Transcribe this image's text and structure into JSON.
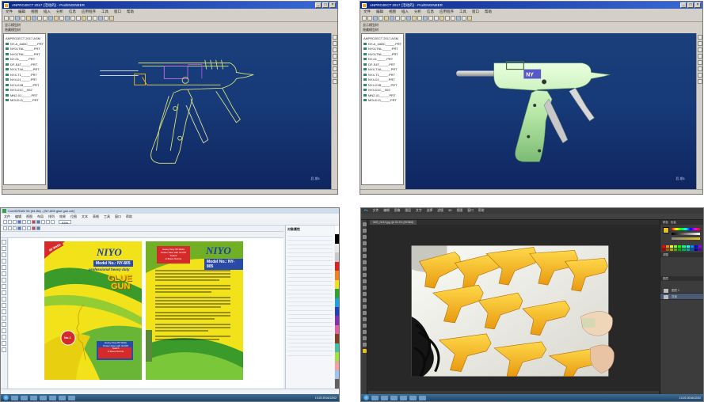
{
  "colors": {
    "cad_viewport": "#173a78",
    "wire": "#d8e07a",
    "shaded_gun": "#c8f0b8",
    "label_yellow": "#f2e21a",
    "label_green": "#3a9a2a",
    "ps_bg": "#2b2b2b",
    "gun_orange": "#f4b21a"
  },
  "cad_left": {
    "title": "ANPROJECT 2017  (活动的)  - Pro/ENGINEER",
    "model_name": "Pro/ENGINEER",
    "menu": [
      "文件",
      "编辑",
      "视图",
      "插入",
      "分析",
      "信息",
      "应用程序",
      "工具",
      "窗口",
      "帮助"
    ],
    "tree_header": "模型树",
    "tree": [
      "ANPROJECT 2017.ASM",
      "NY-A_4ABC_____.PRT",
      "NY01TNL_____.PRT",
      "NY01TNL_____.PRT",
      "NY-01_____.PRT",
      "DF-S4T_____.PRT",
      "NY4-T4A_____.PRT",
      "NY4-T1_____.PRT",
      "NY4-01_____.PRT",
      "NY4-01B_____.PRT",
      "NY4-01C__002",
      "MN2-01_____.PRT",
      "MOLD-D_____.PRT"
    ],
    "toolbar_text": [
      "显示模型树",
      "隐藏模型树"
    ],
    "corner": "后-前1"
  },
  "cad_right": {
    "title": "ANPROJECT 2017  (活动的)  - Pro/ENGINEER",
    "menu": [
      "文件",
      "编辑",
      "视图",
      "插入",
      "分析",
      "信息",
      "应用程序",
      "工具",
      "窗口",
      "帮助"
    ],
    "tree_header": "模型树",
    "tree": [
      "ANPROJECT 2017.ASM",
      "NY-A_4ABC_____.PRT",
      "NY01TNL_____.PRT",
      "NY01TNL_____.PRT",
      "NY-01_____.PRT",
      "DF-S4T_____.PRT",
      "NY4-T4A_____.PRT",
      "NY4-T1_____.PRT",
      "NY4-01_____.PRT",
      "NY4-01B_____.PRT",
      "NY4-01C__002",
      "MN2-01_____.PRT",
      "MOLD-D_____.PRT"
    ],
    "toolbar_text": [
      "显示模型树",
      "隐藏模型树"
    ],
    "corner": "后-前1"
  },
  "corel": {
    "title": "CorelDRAW X6 (64-Bit) - [NY-805 glue gun.cdr]",
    "menu": [
      "文件",
      "编辑",
      "视图",
      "布局",
      "排列",
      "效果",
      "位图",
      "文本",
      "表格",
      "工具",
      "窗口",
      "帮助"
    ],
    "zoom": "93%",
    "brand": "NIYO",
    "model_left": "Model No.: NY-805",
    "model_right": "Model No.: NY-805",
    "watts": "80 Watts",
    "tagline": "professional heavy duty",
    "product_line1": "GLUE",
    "product_line2": "GUN",
    "badge": "No.1",
    "red_box_line1": "Heavy Duty 80 Watts",
    "red_box_line2": "Power Glue with On/Off Switch",
    "red_box_line3": "& Brass Nozzle",
    "bottom_box_line1": "Heavy Duty 80 Watts",
    "bottom_box_line2": "Power Glue with On/Off Switch",
    "bottom_box_line3": "& Brass Nozzle",
    "right_panel_title": "对象属性"
  },
  "photoshop": {
    "menu": [
      "文件",
      "编辑",
      "图像",
      "图层",
      "文字",
      "选择",
      "滤镜",
      "3D",
      "视图",
      "窗口",
      "帮助"
    ],
    "tab": "IMG_0012.jpg @ 33.3% (RGB/8)",
    "panel_color": "颜色",
    "panel_swatches": "色板",
    "panel_adjust": "调整",
    "panel_layers": "图层",
    "layers": [
      "图层 1",
      "背景"
    ]
  },
  "taskbar": {
    "clock": "10:23 2016/12/02"
  }
}
